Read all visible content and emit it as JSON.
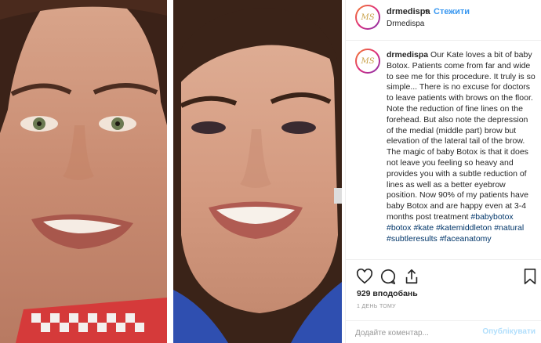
{
  "header": {
    "username": "drmedispa",
    "separator": "•",
    "follow_label": "Стежити",
    "location": "Drmedispa",
    "avatar_initials": "MS"
  },
  "caption": {
    "username": "drmedispa",
    "text_segments": [
      " Our Kate loves a bit of baby Botox. Patients come from far and wide to see me for this procedure. It truly is so simple... There is no excuse for doctors to leave patients with brows on the floor. Note the reduction of fine lines on the forehead. But also note the depression of the medial (middle part) brow but elevation of the lateral tail of the brow. The magic of baby Botox is that it does not leave you feeling so heavy and provides you with a subtle reduction of lines as well as a better eyebrow position. Now 90% of my patients have baby Botox and are happy even at 3-4 months post treatment "
    ],
    "hashtags": [
      "#babybotox",
      "#botox",
      "#kate",
      "#katemiddleton",
      "#natural",
      "#subtleresults",
      "#faceanatomy"
    ]
  },
  "actions": {
    "icons": [
      "heart-icon",
      "comment-icon",
      "share-icon",
      "bookmark-icon"
    ],
    "likes": "929 вподобань",
    "time": "1 ДЕНЬ ТОМУ"
  },
  "comment": {
    "placeholder": "Додайте коментар...",
    "post_label": "Опублікувати"
  },
  "colors": {
    "link": "#3897f0",
    "hashtag": "#003569",
    "post_disabled": "#b2dffc",
    "border": "#efefef"
  }
}
